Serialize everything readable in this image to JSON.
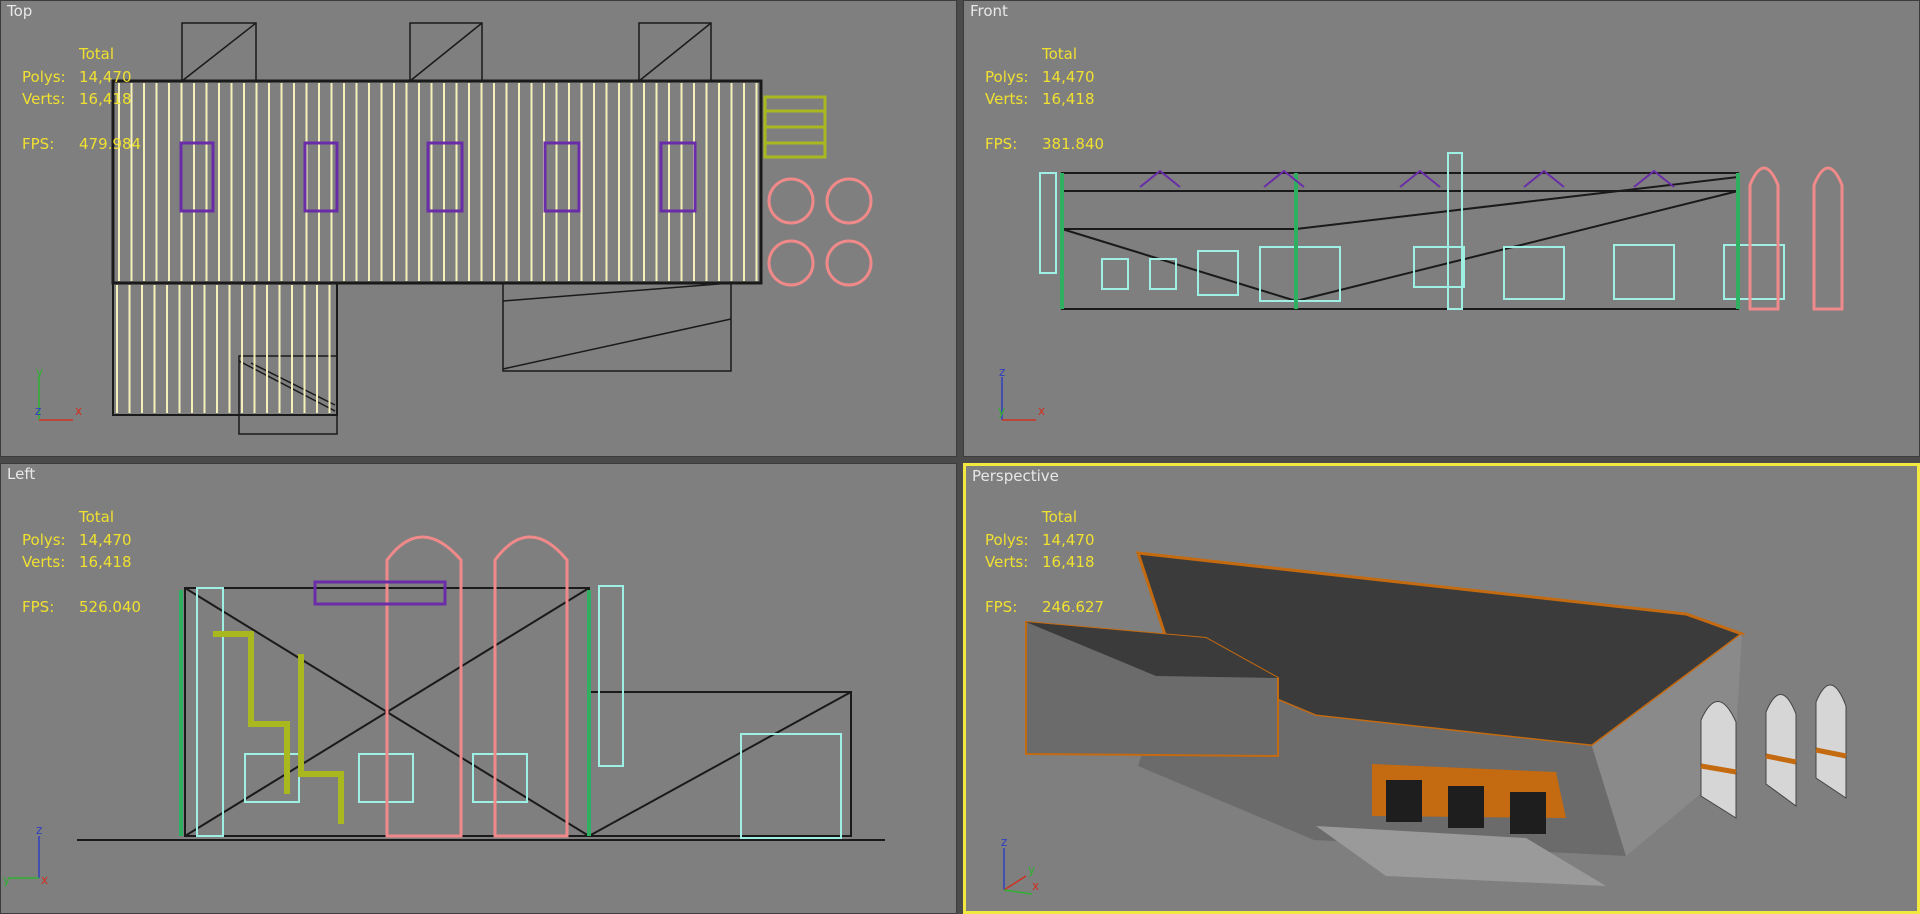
{
  "viewports": [
    {
      "id": "top",
      "title": "Top",
      "stats": {
        "total": "Total",
        "polys_label": "Polys:",
        "polys": "14,470",
        "verts_label": "Verts:",
        "verts": "16,418",
        "fps_label": "FPS:",
        "fps": "479.984"
      },
      "axes": [
        "y",
        "z",
        "x"
      ]
    },
    {
      "id": "front",
      "title": "Front",
      "stats": {
        "total": "Total",
        "polys_label": "Polys:",
        "polys": "14,470",
        "verts_label": "Verts:",
        "verts": "16,418",
        "fps_label": "FPS:",
        "fps": "381.840"
      },
      "axes": [
        "z",
        "y",
        "x"
      ]
    },
    {
      "id": "left",
      "title": "Left",
      "stats": {
        "total": "Total",
        "polys_label": "Polys:",
        "polys": "14,470",
        "verts_label": "Verts:",
        "verts": "16,418",
        "fps_label": "FPS:",
        "fps": "526.040"
      },
      "axes": [
        "z",
        "y",
        "x"
      ]
    },
    {
      "id": "perspective",
      "title": "Perspective",
      "stats": {
        "total": "Total",
        "polys_label": "Polys:",
        "polys": "14,470",
        "verts_label": "Verts:",
        "verts": "16,418",
        "fps_label": "FPS:",
        "fps": "246.627"
      },
      "axes": [
        "z",
        "y",
        "x"
      ],
      "active": true
    }
  ],
  "colors": {
    "viewport_bg": "#7f7f7f",
    "stats_text": "#f0e030",
    "active_border": "#f2e840",
    "wire_roof": "#f4f0b8",
    "wire_windows": "#6a2ca8",
    "wire_silos": "#f08a8a",
    "wire_pipes": "#aab820",
    "wire_ladders": "#9ff0e4",
    "wire_green": "#2fb060"
  }
}
